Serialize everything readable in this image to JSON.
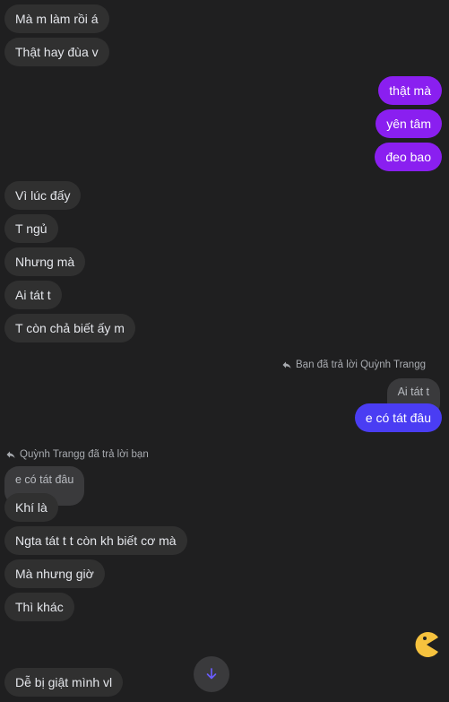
{
  "messages": {
    "m1": "Mà m làm rồi á",
    "m2": "Thật hay đùa v",
    "m3": "thật mà",
    "m4": "yên tâm",
    "m5": "đeo bao",
    "m6": "Vì lúc đấy",
    "m7": "T ngủ",
    "m8": "Nhưng mà",
    "m9": "Ai tát t",
    "m10": "T còn chả biết ấy m",
    "m11_reply_hint": "Bạn đã trả lời Quỳnh Trangg",
    "m11_quoted": "Ai tát t",
    "m11": "e có tát đâu",
    "m12_reply_hint": "Quỳnh Trangg đã trả lời bạn",
    "m12_quoted": "e có tát đâu",
    "m12": "Khí là",
    "m13": "Ngta tát t t còn kh biết cơ mà",
    "m14": "Mà nhưng giờ",
    "m15": "Thì khác",
    "m16": "Dễ bị giật mình vl"
  },
  "colors": {
    "background": "#1f1f20",
    "incoming": "#303030",
    "outgoing_purple": "#8a1ff0",
    "outgoing_blue": "#4a3df3"
  },
  "icons": {
    "reply": "reply-arrow-icon",
    "scroll": "arrow-down-icon",
    "reaction": "pacman-sticker-icon"
  }
}
